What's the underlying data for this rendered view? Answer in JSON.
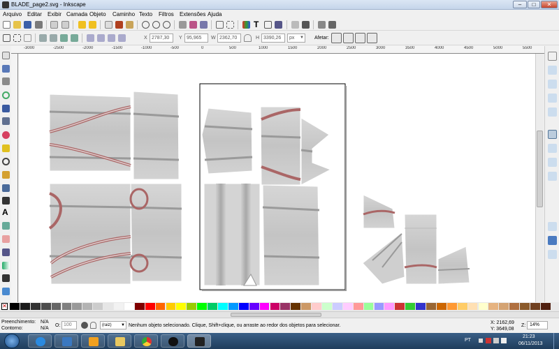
{
  "window": {
    "title": "BLADE_page2.svg - Inkscape"
  },
  "menu": [
    "Arquivo",
    "Editar",
    "Exibir",
    "Camada",
    "Objeto",
    "Caminho",
    "Texto",
    "Filtros",
    "Extensões",
    "Ajuda"
  ],
  "controls": {
    "x_label": "X",
    "x_value": "2787,30",
    "y_label": "Y",
    "y_value": "95,965",
    "w_label": "W",
    "w_value": "2362,70",
    "h_label": "H",
    "h_value": "3390,26",
    "unit": "px",
    "affect_label": "Afetar:"
  },
  "ruler": {
    "labels": [
      "-3000",
      "-2500",
      "-2000",
      "-1500",
      "-1000",
      "-500",
      "0",
      "500",
      "1000",
      "1500",
      "2000",
      "2500",
      "3000",
      "3500",
      "4000",
      "4500",
      "5000",
      "5500",
      "6000"
    ]
  },
  "status": {
    "fill_label": "Preenchimento:",
    "fill_value": "N/A",
    "stroke_label": "Contorno:",
    "stroke_value": "N/A",
    "opacity_label": "O:",
    "opacity_value": "100",
    "layer": "(raiz)",
    "message": "Nenhum objeto selecionado. Clique, Shift+clique, ou arraste ao redor dos objetos para selecionar.",
    "cursor_x": "X: 2162,69",
    "cursor_y": "Y: 3649,08",
    "zoom_label": "Z:",
    "zoom_value": "14%"
  },
  "taskbar": {
    "lang": "PT",
    "time": "21:23",
    "date": "06/11/2013",
    "apps": [
      "start-orb",
      "internet-explorer",
      "media-center",
      "media-player",
      "file-explorer",
      "chrome",
      "hp-utility",
      "inkscape"
    ]
  },
  "palette": [
    "#000000",
    "#1a1a1a",
    "#333333",
    "#4d4d4d",
    "#666666",
    "#808080",
    "#999999",
    "#b3b3b3",
    "#cccccc",
    "#e6e6e6",
    "#f2f2f2",
    "#ffffff",
    "#800000",
    "#ff0000",
    "#ff6600",
    "#ffcc00",
    "#ffff00",
    "#99cc00",
    "#00ff00",
    "#00cc66",
    "#00ffff",
    "#0099ff",
    "#0000ff",
    "#6600ff",
    "#ff00ff",
    "#cc0066",
    "#993366",
    "#663300",
    "#cc9966",
    "#ffcccc",
    "#ccffcc",
    "#ccccff",
    "#ffccff",
    "#ff9999",
    "#99ff99",
    "#9999ff",
    "#ff99ff",
    "#cc3333",
    "#33cc33",
    "#3333cc",
    "#996633",
    "#cc6600",
    "#ff9933",
    "#ffcc66",
    "#ffe0b3",
    "#ffffcc",
    "#e6b380",
    "#d4a373",
    "#b07040",
    "#8b5a2b",
    "#704020",
    "#502010"
  ]
}
